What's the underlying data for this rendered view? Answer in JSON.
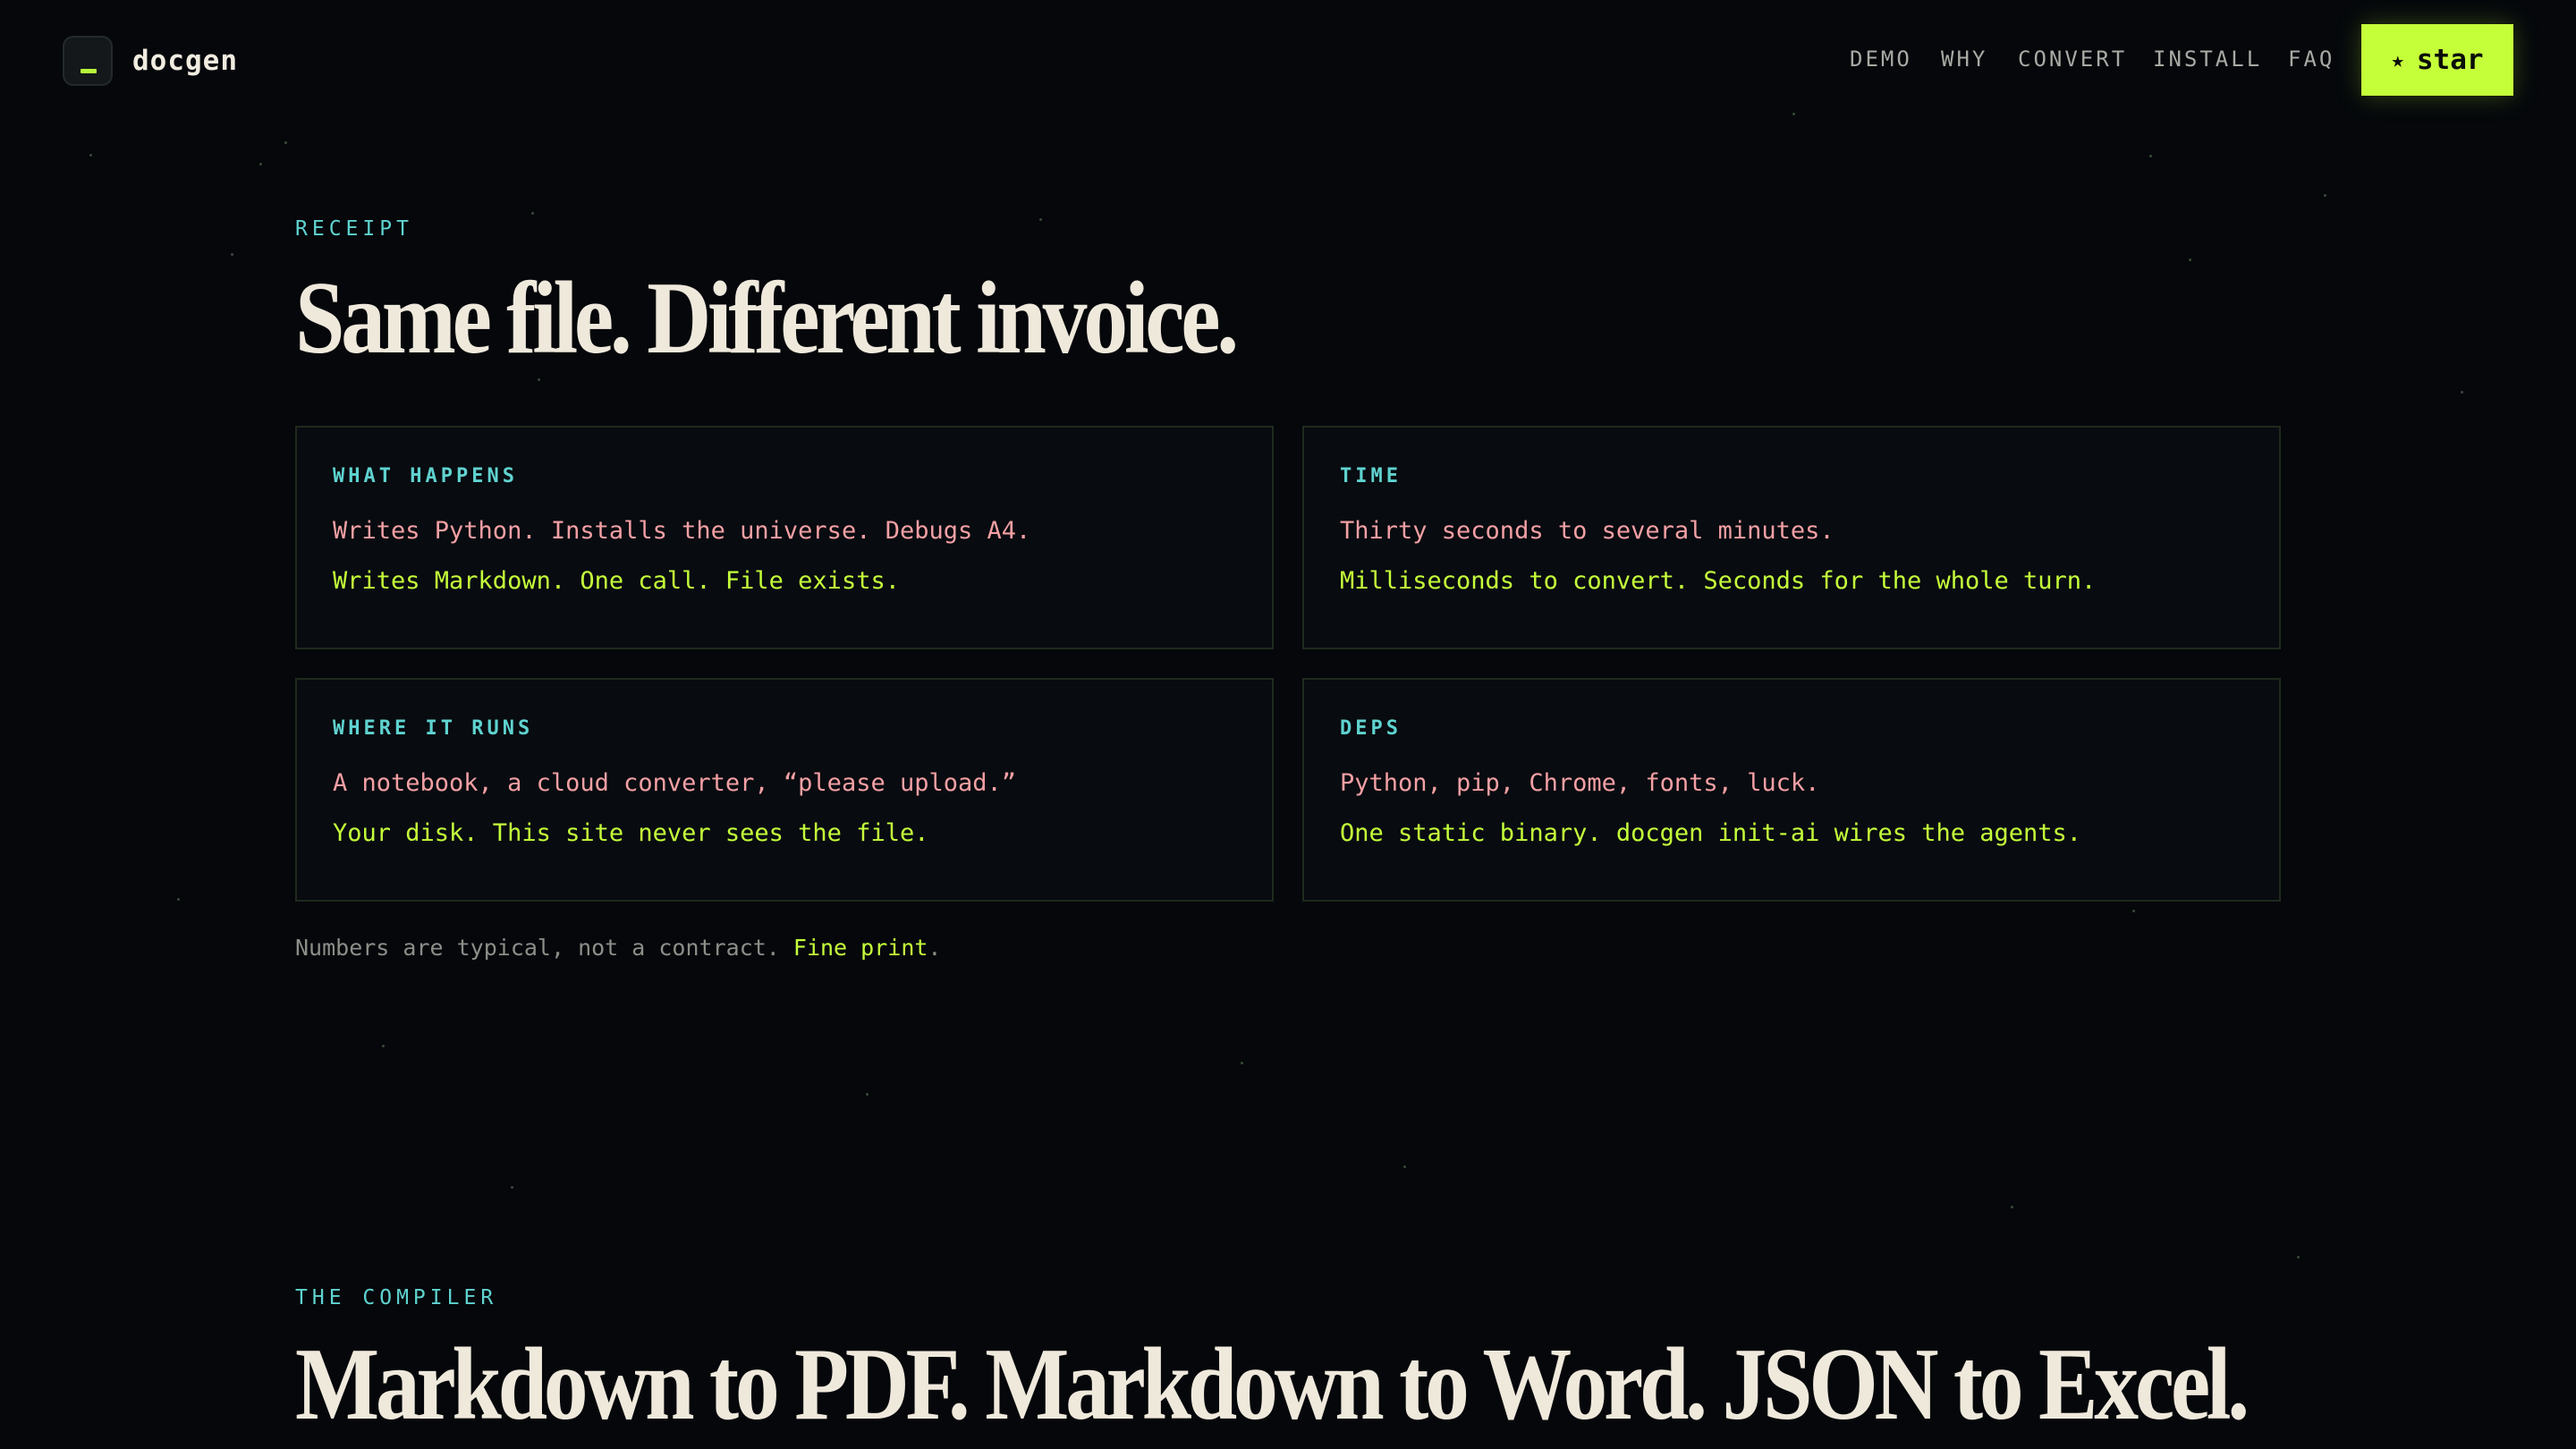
{
  "nav": {
    "brand": "docgen",
    "links": [
      "DEMO",
      "WHY",
      "CONVERT",
      "INSTALL",
      "FAQ"
    ],
    "star_label": "star",
    "star_glyph": "★"
  },
  "receipt": {
    "eyebrow": "RECEIPT",
    "title": "Same file. Different invoice.",
    "cards": [
      {
        "label": "WHAT HAPPENS",
        "old": "Writes Python. Installs the universe. Debugs A4.",
        "new": "Writes Markdown. One call. File exists."
      },
      {
        "label": "TIME",
        "old": "Thirty seconds to several minutes.",
        "new": "Milliseconds to convert. Seconds for the whole turn."
      },
      {
        "label": "WHERE IT RUNS",
        "old": "A notebook, a cloud converter, “please upload.”",
        "new": "Your disk. This site never sees the file."
      },
      {
        "label": "DEPS",
        "old": "Python, pip, Chrome, fonts, luck.",
        "new": "One static binary. docgen init-ai wires the agents."
      }
    ],
    "fineprint_text": "Numbers are typical, not a contract. ",
    "fineprint_link": "Fine print",
    "fineprint_end": "."
  },
  "compiler": {
    "eyebrow": "THE COMPILER",
    "title": "Markdown to PDF. Markdown to Word. JSON to Excel."
  },
  "colors": {
    "accent": "#c5ff3a",
    "cyan": "#5fd3d0",
    "old_text": "#f3a0a4",
    "background": "#05070b"
  }
}
